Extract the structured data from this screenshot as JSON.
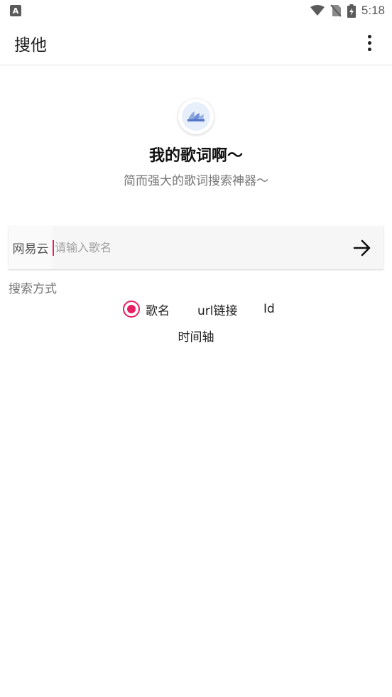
{
  "status": {
    "app_badge": "A",
    "time": "5:18"
  },
  "app_bar": {
    "title": "搜他"
  },
  "hero": {
    "headline": "我的歌词啊〜",
    "subhead": "简而强大的歌词搜索神器〜"
  },
  "search": {
    "source": "网易云",
    "placeholder": "请输入歌名",
    "value": ""
  },
  "search_mode": {
    "label": "搜索方式",
    "options": [
      "歌名",
      "url链接",
      "Id",
      "时间轴"
    ],
    "selected": "歌名"
  },
  "colors": {
    "accent": "#e91e63",
    "text": "#212121",
    "secondary": "#757575"
  }
}
